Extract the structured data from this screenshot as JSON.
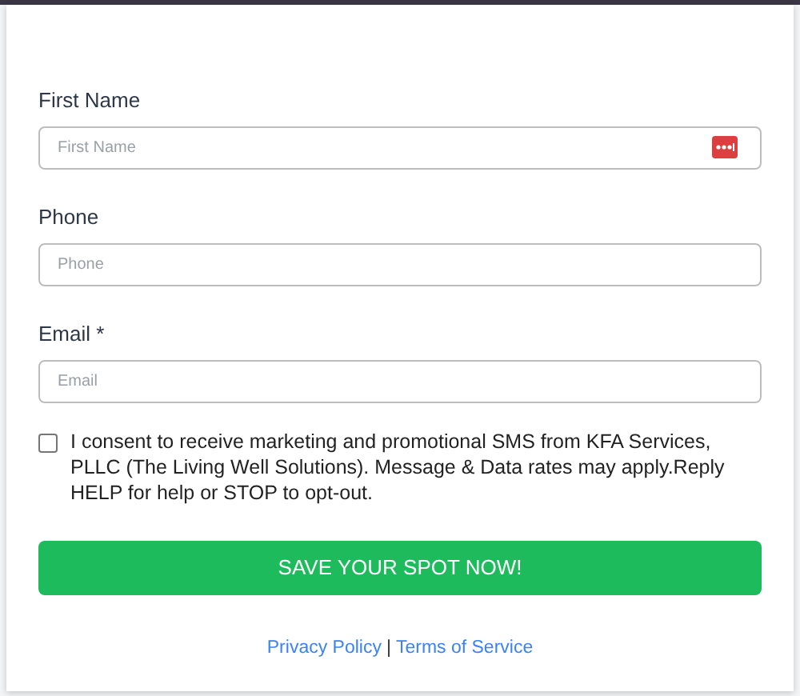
{
  "fields": [
    {
      "label": "First Name",
      "placeholder": "First Name",
      "menu_icon": true
    },
    {
      "label": "Phone",
      "placeholder": "Phone",
      "menu_icon": false
    },
    {
      "label": "Email *",
      "placeholder": "Email",
      "menu_icon": false
    }
  ],
  "consent": {
    "checked": false,
    "text": "I consent to receive marketing and promotional SMS from KFA Services, PLLC (The Living Well Solutions). Message & Data rates may apply.Reply HELP for help or STOP to opt-out."
  },
  "submit": "SAVE YOUR SPOT NOW!",
  "links": {
    "privacy": "Privacy Policy",
    "separator": "|",
    "terms": "Terms of Service"
  }
}
